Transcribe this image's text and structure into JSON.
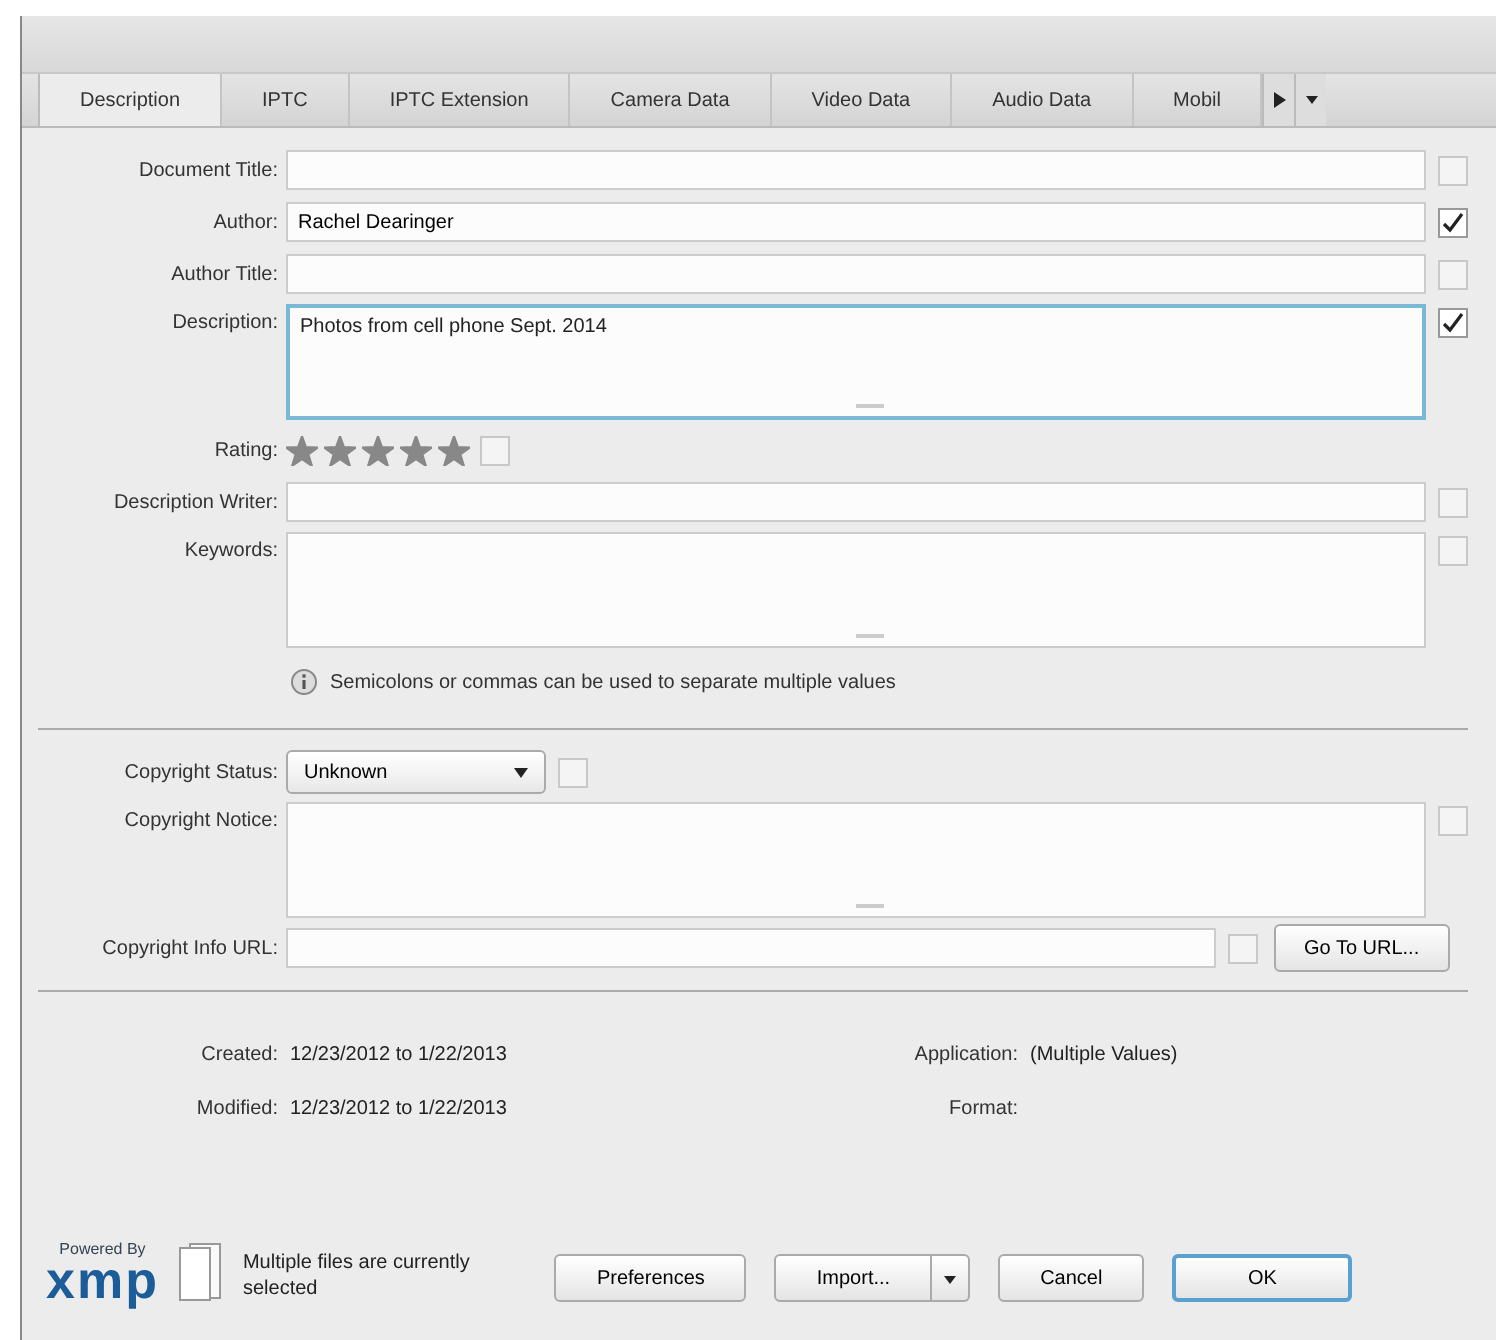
{
  "tabs": [
    {
      "label": "Description",
      "selected": true
    },
    {
      "label": "IPTC",
      "selected": false
    },
    {
      "label": "IPTC Extension",
      "selected": false
    },
    {
      "label": "Camera Data",
      "selected": false
    },
    {
      "label": "Video Data",
      "selected": false
    },
    {
      "label": "Audio Data",
      "selected": false
    },
    {
      "label": "Mobil",
      "selected": false
    }
  ],
  "fields": [
    {
      "kind": "text",
      "label": "Document Title:",
      "checked": false
    },
    {
      "kind": "text",
      "label": "Author:",
      "value": "Rachel Dearinger",
      "checked": true
    },
    {
      "kind": "text",
      "label": "Author Title:",
      "checked": false
    },
    {
      "kind": "area",
      "label": "Description:",
      "value": "Photos from cell phone Sept. 2014",
      "checked": true,
      "focused": true
    },
    {
      "kind": "rating",
      "label": "Rating:",
      "stars": 5
    },
    {
      "kind": "text",
      "label": "Description Writer:",
      "checked": false
    },
    {
      "kind": "area",
      "label": "Keywords:",
      "checked": false,
      "focused": false
    },
    {
      "kind": "info",
      "text": "Semicolons or commas can be used to separate multiple values"
    },
    {
      "kind": "divider"
    },
    {
      "kind": "select",
      "label": "Copyright Status:",
      "value": "Unknown",
      "checked": false
    },
    {
      "kind": "area",
      "label": "Copyright Notice:",
      "checked": false,
      "focused": false
    },
    {
      "kind": "url",
      "label": "Copyright Info URL:",
      "checked": false,
      "button": "Go To URL..."
    },
    {
      "kind": "divider"
    }
  ],
  "info": [
    {
      "label": "Created:",
      "value": "12/23/2012 to 1/22/2013",
      "label2": "Application:",
      "value2": "(Multiple Values)"
    },
    {
      "label": "Modified:",
      "value": "12/23/2012 to 1/22/2013",
      "label2": "Format:"
    }
  ],
  "footer": {
    "powered": "Powered By",
    "logo": "xmp",
    "message": "Multiple files are currently selected",
    "buttons": [
      {
        "kind": "plain",
        "label": "Preferences"
      },
      {
        "kind": "split",
        "label": "Import..."
      },
      {
        "kind": "plain",
        "label": "Cancel"
      },
      {
        "kind": "default",
        "label": "OK"
      }
    ]
  }
}
